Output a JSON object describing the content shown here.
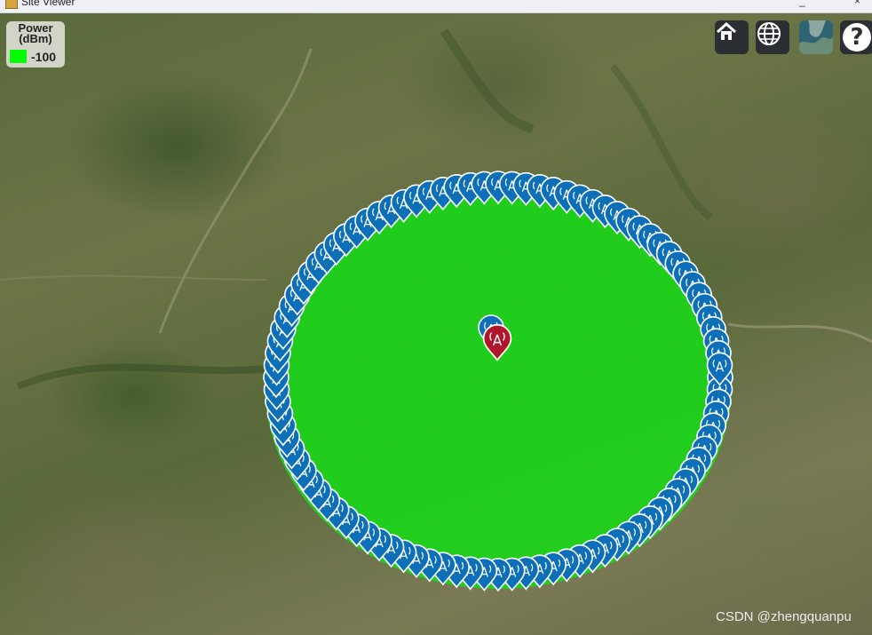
{
  "window": {
    "title": "Site Viewer"
  },
  "legend": {
    "title_line1": "Power",
    "title_line2": "(dBm)",
    "swatch_color": "#00ff00",
    "value": "-100"
  },
  "toolbar": {
    "home": {
      "icon": "home-icon"
    },
    "globe": {
      "icon": "globe-icon"
    },
    "basemap": {
      "icon": "basemap-thumbnail"
    },
    "help": {
      "icon": "help-icon",
      "label": "?"
    }
  },
  "coverage": {
    "fill_color": "#1ed21a"
  },
  "receivers": {
    "count": 100,
    "color": "#0d6fb8"
  },
  "transmitter": {
    "color": "#b0152b"
  },
  "watermark": "CSDN @zhengquanpu"
}
